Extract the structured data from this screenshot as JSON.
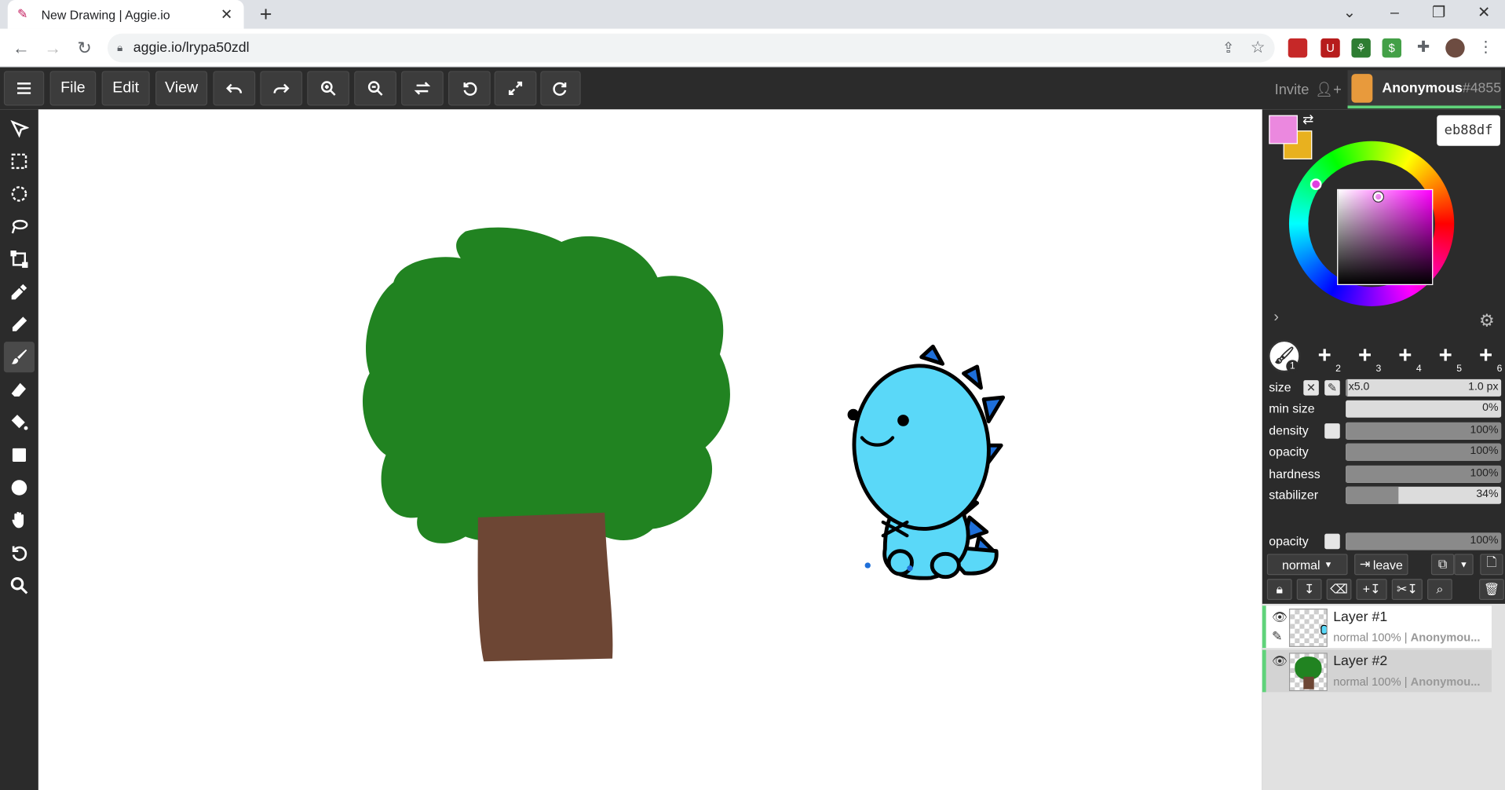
{
  "browser": {
    "tab_title": "New Drawing | Aggie.io",
    "url": "aggie.io/lrypa50zdl"
  },
  "menu": {
    "file": "File",
    "edit": "Edit",
    "view": "View"
  },
  "header": {
    "invite": "Invite",
    "user_name": "Anonymous",
    "user_tag": "#4855"
  },
  "colors": {
    "primary": "#eb88df",
    "secondary": "#e8b11f",
    "hex_value": "eb88df",
    "accent": "#5fd37a"
  },
  "brushes": [
    {
      "num": "1",
      "active": true
    },
    {
      "num": "2"
    },
    {
      "num": "3"
    },
    {
      "num": "4"
    },
    {
      "num": "5"
    },
    {
      "num": "6"
    }
  ],
  "brush_settings": {
    "size_label": "size",
    "size_multiplier": "x5.0",
    "size_value": "1.0 px",
    "min_size_label": "min size",
    "min_size_value": "0%",
    "density_label": "density",
    "density_value": "100%",
    "opacity_label": "opacity",
    "opacity_value": "100%",
    "hardness_label": "hardness",
    "hardness_value": "100%",
    "stabilizer_label": "stabilizer",
    "stabilizer_value": "34%"
  },
  "layer_settings": {
    "opacity_label": "opacity",
    "opacity_value": "100%",
    "blend_mode": "normal",
    "leave_label": "leave"
  },
  "layers": [
    {
      "name": "Layer #1",
      "meta": "normal 100% |",
      "owner": "Anonymou..."
    },
    {
      "name": "Layer #2",
      "meta": "normal 100% |",
      "owner": "Anonymou..."
    }
  ]
}
